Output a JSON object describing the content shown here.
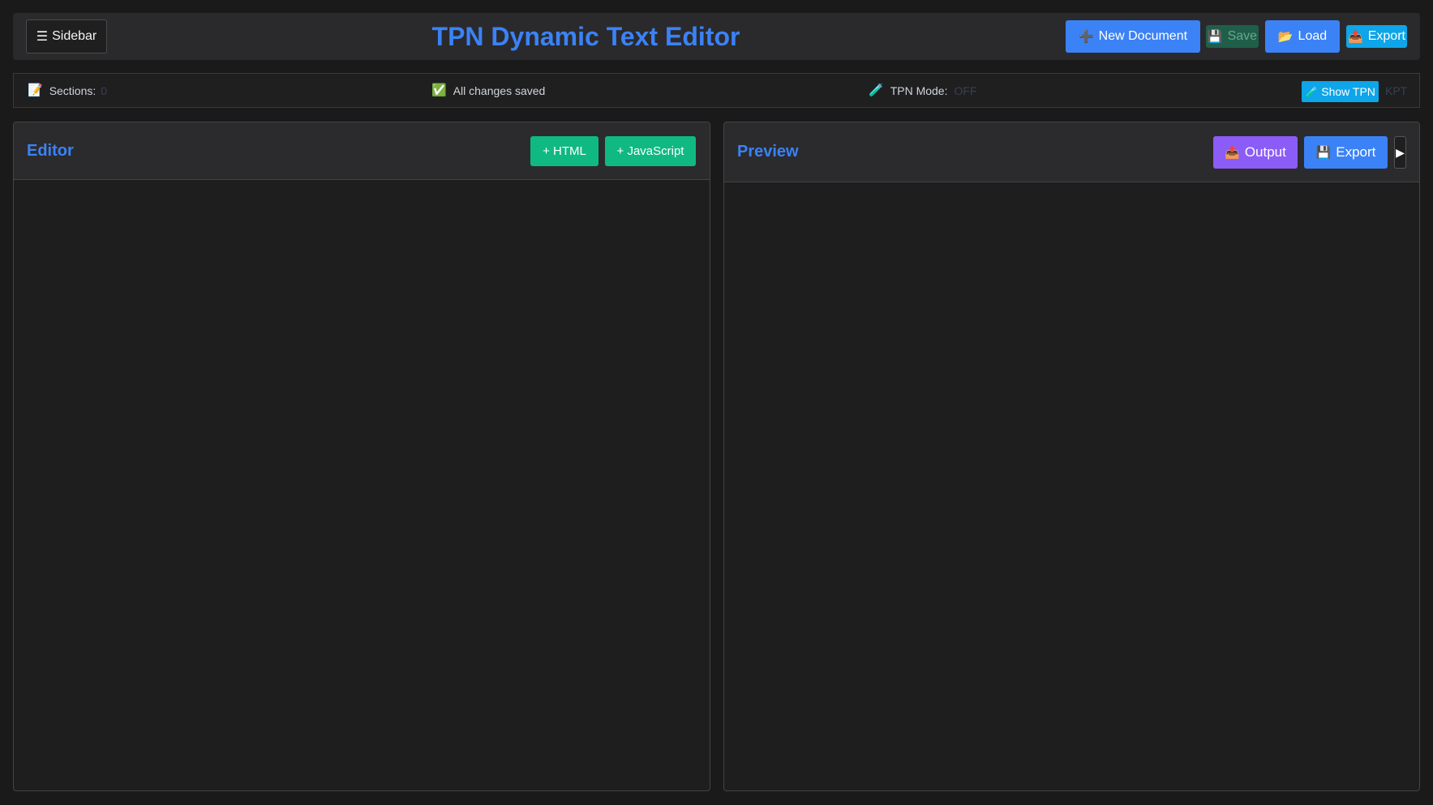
{
  "header": {
    "sidebar_icon": "☰",
    "sidebar_label": "Sidebar",
    "title": "TPN Dynamic Text Editor",
    "new_icon": "➕",
    "new_label": "New Document",
    "save_icon": "💾",
    "save_label": "Save",
    "load_icon": "📂",
    "load_label": "Load",
    "export_icon": "📤",
    "export_label": "Export"
  },
  "statusbar": {
    "sections_icon": "📝",
    "sections_label": "Sections:",
    "sections_count": "0",
    "saved_icon": "✅",
    "saved_text": "All changes saved",
    "tpn_icon": "🧪",
    "tpn_label": "TPN Mode:",
    "tpn_value": "OFF",
    "show_tpn_icon": "🧪",
    "show_tpn_label": "Show TPN",
    "kpt_label": "KPT"
  },
  "editor": {
    "title": "Editor",
    "add_html_label": "+ HTML",
    "add_js_label": "+ JavaScript"
  },
  "preview": {
    "title": "Preview",
    "output_icon": "📤",
    "output_label": "Output",
    "export_icon": "💾",
    "export_label": "Export",
    "run_icon": "▶"
  },
  "colors": {
    "accent": "#3b82f6",
    "green": "#10b981",
    "purple": "#8b5cf6",
    "cyan": "#0ea5e9",
    "background": "#1a1a1a"
  }
}
